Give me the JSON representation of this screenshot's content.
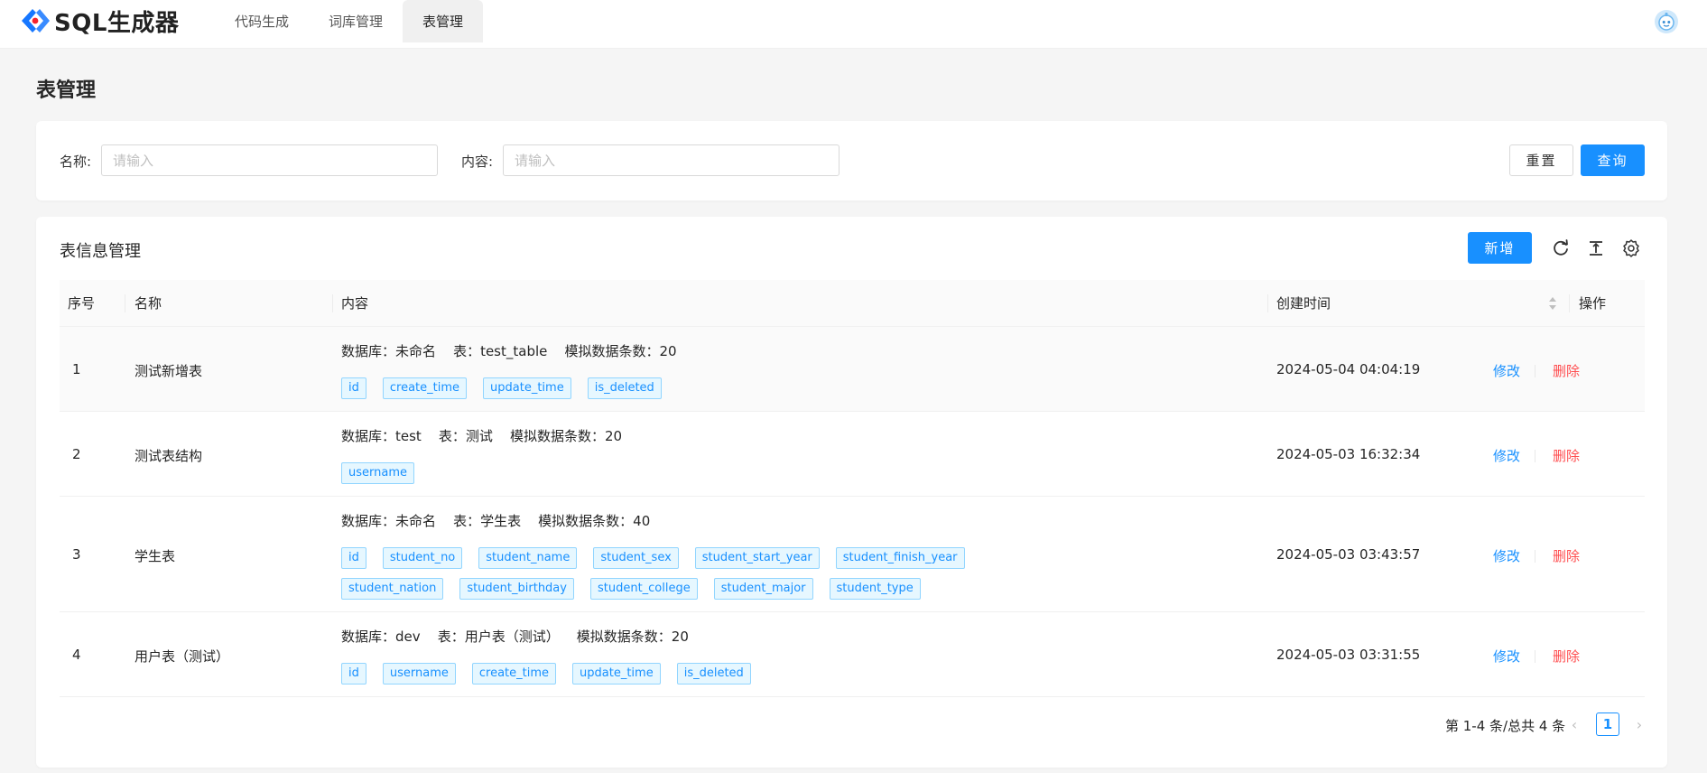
{
  "app": {
    "logo_text": "SQL生成器"
  },
  "nav": {
    "items": [
      {
        "label": "代码生成",
        "active": false
      },
      {
        "label": "词库管理",
        "active": false
      },
      {
        "label": "表管理",
        "active": true
      }
    ]
  },
  "page": {
    "title": "表管理"
  },
  "search": {
    "name_label": "名称:",
    "name_placeholder": "请输入",
    "content_label": "内容:",
    "content_placeholder": "请输入",
    "reset_label": "重置",
    "query_label": "查询"
  },
  "table_card": {
    "title": "表信息管理",
    "add_label": "新增",
    "icons": [
      "reload-icon",
      "column-height-icon",
      "setting-icon"
    ]
  },
  "table": {
    "columns": [
      "序号",
      "名称",
      "内容",
      "创建时间",
      "操作"
    ],
    "action_edit": "修改",
    "action_delete": "删除",
    "rows": [
      {
        "index": "1",
        "name": "测试新增表",
        "meta": "数据库：未命名    表：test_table    模拟数据条数：20",
        "tags": [
          "id",
          "create_time",
          "update_time",
          "is_deleted"
        ],
        "created": "2024-05-04 04:04:19"
      },
      {
        "index": "2",
        "name": "测试表结构",
        "meta": "数据库：test    表：测试    模拟数据条数：20",
        "tags": [
          "username"
        ],
        "created": "2024-05-03 16:32:34"
      },
      {
        "index": "3",
        "name": "学生表",
        "meta": "数据库：未命名    表：学生表    模拟数据条数：40",
        "tags": [
          "id",
          "student_no",
          "student_name",
          "student_sex",
          "student_start_year",
          "student_finish_year",
          "student_nation",
          "student_birthday",
          "student_college",
          "student_major",
          "student_type"
        ],
        "created": "2024-05-03 03:43:57"
      },
      {
        "index": "4",
        "name": "用户表（测试）",
        "meta": "数据库：dev    表：用户表（测试）    模拟数据条数：20",
        "tags": [
          "id",
          "username",
          "create_time",
          "update_time",
          "is_deleted"
        ],
        "created": "2024-05-03 03:31:55"
      }
    ]
  },
  "pagination": {
    "total_text": "第 1-4 条/总共 4 条",
    "current_page": "1"
  },
  "colors": {
    "primary": "#1890ff",
    "danger": "#ff4d4f",
    "tag_bg": "#e6f7ff",
    "tag_border": "#91d5ff"
  }
}
